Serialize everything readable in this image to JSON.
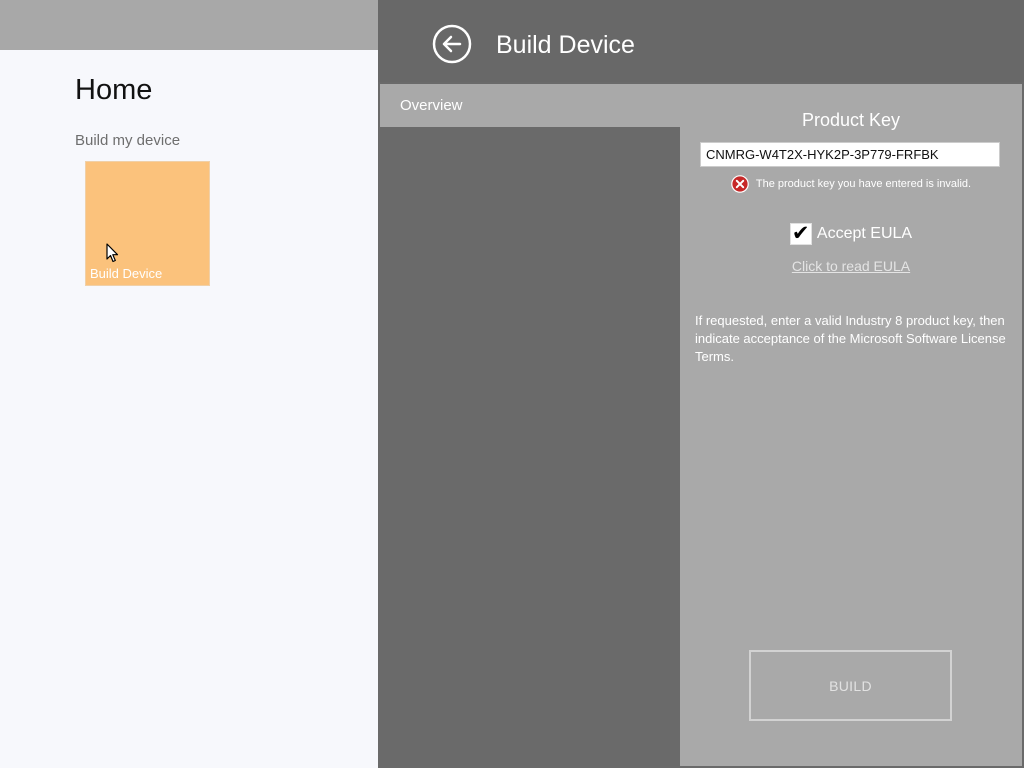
{
  "home": {
    "title": "Home",
    "section_label": "Build my device",
    "tile": {
      "label": "Build Device",
      "color": "#fbc27c"
    }
  },
  "flyout": {
    "title": "Build Device",
    "back_icon": "back-arrow-circle-icon",
    "tabs": [
      {
        "label": "Overview"
      }
    ],
    "product_key": {
      "title": "Product Key",
      "value": "CNMRG-W4T2X-HYK2P-3P779-FRFBK",
      "error_icon": "error-x-icon",
      "error_message": "The product key you have entered is invalid."
    },
    "eula": {
      "checked": true,
      "label": "Accept EULA",
      "link": "Click to read EULA"
    },
    "help_text": "If requested, enter a valid Industry 8 product key, then indicate acceptance of the Microsoft Software License Terms.",
    "build_label": "BUILD"
  },
  "colors": {
    "error": "#c62828",
    "flyout_dark": "#6a6a6a",
    "flyout_light": "#a9a9a9"
  }
}
